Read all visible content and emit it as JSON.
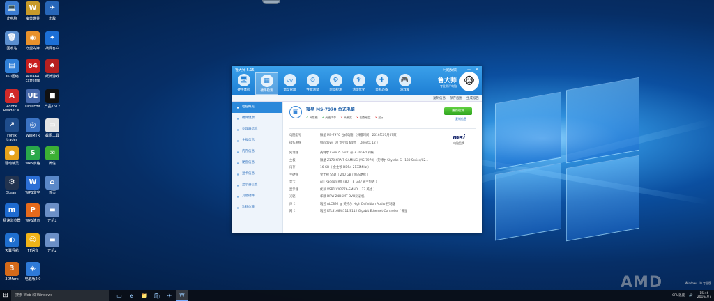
{
  "desktop_icons": [
    {
      "label": "此电脑",
      "glyph": "💻",
      "color": "#3b7bd1"
    },
    {
      "label": "魔兽世界",
      "glyph": "W",
      "color": "#c79a2a"
    },
    {
      "label": "击敌",
      "glyph": "✈",
      "color": "#2766b8"
    },
    {
      "label": "回收站",
      "glyph": "🗑",
      "color": "#5a8fd0"
    },
    {
      "label": "守望先锋",
      "glyph": "◉",
      "color": "#e8912c"
    },
    {
      "label": "战网客户",
      "glyph": "✦",
      "color": "#1c6fd6"
    },
    {
      "label": "360压缩",
      "glyph": "▤",
      "color": "#2f7fd8"
    },
    {
      "label": "AIDA64 Extreme",
      "glyph": "64",
      "color": "#c81e1e"
    },
    {
      "label": "纸牌游戏",
      "glyph": "♠",
      "color": "#b52020"
    },
    {
      "label": "Adobe Reader XI",
      "glyph": "A",
      "color": "#d02a2a"
    },
    {
      "label": "UltraEdit",
      "glyph": "UE",
      "color": "#4466aa"
    },
    {
      "label": "产品1617",
      "glyph": "■",
      "color": "#111111"
    },
    {
      "label": "Forex trader",
      "glyph": "↗",
      "color": "#1f4d8c"
    },
    {
      "label": "WinMTR",
      "glyph": "◎",
      "color": "#3b73c4"
    },
    {
      "label": "截图工具",
      "glyph": "▭",
      "color": "#e4e4e4"
    },
    {
      "label": "驱动精灵",
      "glyph": "●",
      "color": "#e6a21b"
    },
    {
      "label": "WPS表格",
      "glyph": "S",
      "color": "#2aa84a"
    },
    {
      "label": "微信",
      "glyph": "✉",
      "color": "#3cb034"
    },
    {
      "label": "Steam",
      "glyph": "⚙",
      "color": "#22334f"
    },
    {
      "label": "WPS文字",
      "glyph": "W",
      "color": "#2c6fd6"
    },
    {
      "label": "首页",
      "glyph": "⌂",
      "color": "#5a88c8"
    },
    {
      "label": "极速浏览器",
      "glyph": "m",
      "color": "#1e6bd0"
    },
    {
      "label": "WPS演示",
      "glyph": "P",
      "color": "#e56a1c"
    },
    {
      "label": "开机1",
      "glyph": "▬",
      "color": "#6b8fc6"
    },
    {
      "label": "天翼导航",
      "glyph": "◐",
      "color": "#1f6fcf"
    },
    {
      "label": "YY语音",
      "glyph": "☺",
      "color": "#f0b419"
    },
    {
      "label": "开机2",
      "glyph": "▬",
      "color": "#6b8fc6"
    },
    {
      "label": "3DMark",
      "glyph": "3",
      "color": "#d46a1a"
    },
    {
      "label": "电脑版2.0",
      "glyph": "◈",
      "color": "#2e7ad8"
    }
  ],
  "app": {
    "title": "鲁大师 5.15",
    "controls": [
      "问题反馈",
      "—",
      "✕"
    ],
    "toolbar": [
      {
        "label": "硬件体检",
        "glyph": "🖥"
      },
      {
        "label": "硬件检测",
        "glyph": "▦",
        "active": true
      },
      {
        "label": "温度管理",
        "glyph": "〰"
      },
      {
        "label": "性能测试",
        "glyph": "⏱"
      },
      {
        "label": "驱动检测",
        "glyph": "⚙"
      },
      {
        "label": "清理优化",
        "glyph": "♆"
      },
      {
        "label": "装机必备",
        "glyph": "✚"
      },
      {
        "label": "游戏库",
        "glyph": "🎮"
      }
    ],
    "brand_name": "鲁大师",
    "brand_sub": "专业测评电脑",
    "subbar": [
      "复制信息",
      "保存截图",
      "生成报告"
    ],
    "sidebar": [
      "电脑概览",
      "硬件健康",
      "处理器信息",
      "主板信息",
      "内存信息",
      "硬盘信息",
      "显卡信息",
      "显示器信息",
      "其他硬件",
      "功耗估算"
    ],
    "model_name": "微星 MS-7970 台式电脑",
    "checks": [
      {
        "mark": "✔",
        "label": "高性能",
        "ok": true
      },
      {
        "mark": "✔",
        "label": "高速内存",
        "ok": true
      },
      {
        "mark": "✕",
        "label": "高带宽",
        "ok": false
      },
      {
        "mark": "✕",
        "label": "固态硬盘",
        "ok": false
      },
      {
        "mark": "✕",
        "label": "显示",
        "ok": false
      }
    ],
    "detect_button": "重新检测",
    "share_link": "复制信息",
    "info_rows": [
      {
        "k": "电脑型号",
        "v": "微星 MS-7970 台式电脑 （扫描时间：2016年07月07日）"
      },
      {
        "k": "操作系统",
        "v": "Windows 10 专业版 64位（ DirectX 12 ）"
      },
      {
        "k": "处理器",
        "v": "英特尔 Core i5 6600 @ 3.30GHz 四核",
        "gap": true
      },
      {
        "k": "主板",
        "v": "微星 Z170 KRAIT GAMING (MS-7970)（英特尔 Skylake-S - 130 Series/C2..."
      },
      {
        "k": "内存",
        "v": "16 GB（ 金士顿 DDR4 2133MHz ）"
      },
      {
        "k": "主硬盘",
        "v": "金士顿 SSD（ 240 GB / 固态硬盘 ）"
      },
      {
        "k": "显卡",
        "v": "ATI Radeon RX 480（ 8 GB / 迪兰恒进 ）"
      },
      {
        "k": "显示器",
        "v": "优派 VSB1 VX2776-SMHD（ 27 英寸 ）"
      },
      {
        "k": "光驱",
        "v": "华硕 DRW-24D5MT DVD刻录机"
      },
      {
        "k": "声卡",
        "v": "瑞昱 ALC892 @ 英特尔 High Definition Audio 控制器"
      },
      {
        "k": "网卡",
        "v": "瑞昱 RTL8168/8111/8112 Gigabit Ethernet Controller / 微星"
      }
    ],
    "msi_logo": "msi",
    "msi_sub": "电脑品牌"
  },
  "taskbar": {
    "search_placeholder": "搜索 Web 和 Windows",
    "items": [
      "▭",
      "e",
      "📁",
      "🛍",
      "✈",
      "W"
    ],
    "tray_text": "CPU温度",
    "time": "15:46",
    "date": "2016/7/7"
  },
  "watermark": "AMD",
  "watermark_sub": "Windows 10 专业版"
}
